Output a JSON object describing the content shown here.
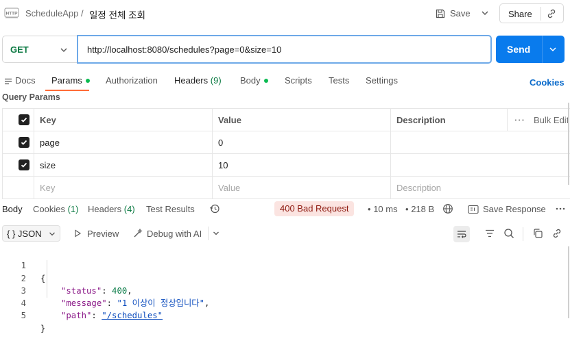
{
  "header": {
    "collection": "ScheduleApp",
    "separator": "/",
    "request_name": "일정 전체 조회",
    "save_label": "Save",
    "share_label": "Share"
  },
  "request": {
    "method": "GET",
    "url": "http://localhost:8080/schedules?page=0&size=10",
    "send_label": "Send"
  },
  "request_tabs": [
    {
      "label": "Docs"
    },
    {
      "label": "Params"
    },
    {
      "label": "Authorization"
    },
    {
      "label": "Headers",
      "count": "(9)"
    },
    {
      "label": "Body"
    },
    {
      "label": "Scripts"
    },
    {
      "label": "Tests"
    },
    {
      "label": "Settings"
    }
  ],
  "active_request_tab": "Params",
  "cookies_label": "Cookies",
  "params": {
    "title": "Query Params",
    "headers": {
      "key": "Key",
      "value": "Value",
      "description": "Description",
      "bulk_edit": "Bulk Edit"
    },
    "rows": [
      {
        "key": "page",
        "value": "0",
        "checked": true
      },
      {
        "key": "size",
        "value": "10",
        "checked": true
      }
    ],
    "placeholders": {
      "key": "Key",
      "value": "Value",
      "description": "Description"
    }
  },
  "response_tabs": [
    {
      "label": "Body"
    },
    {
      "label": "Cookies",
      "count": "(1)"
    },
    {
      "label": "Headers",
      "count": "(4)"
    },
    {
      "label": "Test Results"
    }
  ],
  "response_meta": {
    "status": "400 Bad Request",
    "time": "10 ms",
    "size": "218 B",
    "save_response_label": "Save Response"
  },
  "response_toolbar": {
    "format": "JSON",
    "preview_label": "Preview",
    "debug_label": "Debug with AI"
  },
  "response_body": {
    "line_numbers": [
      "1",
      "2",
      "3",
      "4",
      "5"
    ],
    "open_brace": "{",
    "close_brace": "}",
    "fields": [
      {
        "key": "\"status\"",
        "value": "400",
        "type": "number"
      },
      {
        "key": "\"message\"",
        "value": "\"1 이상이 정상입니다\"",
        "type": "string"
      },
      {
        "key": "\"path\"",
        "value": "\"/schedules\"",
        "type": "link"
      }
    ]
  },
  "colors": {
    "accent_orange": "#ff6c37",
    "send_blue": "#097bed",
    "method_green": "#0c7a43",
    "error_bg": "#fbe4e1",
    "error_text": "#8e1a10"
  }
}
